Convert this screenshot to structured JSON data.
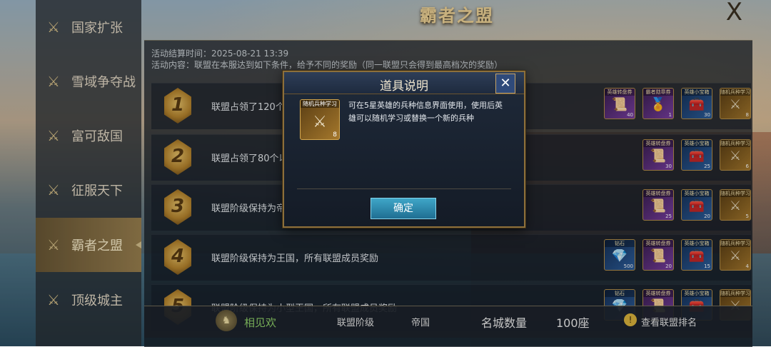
{
  "page_title": "霸者之盟",
  "close_label": "X",
  "sidebar": {
    "items": [
      {
        "label": "国家扩张",
        "active": false
      },
      {
        "label": "雪域争夺战",
        "active": false
      },
      {
        "label": "富可敌国",
        "active": false
      },
      {
        "label": "征服天下",
        "active": false
      },
      {
        "label": "霸者之盟",
        "active": true
      },
      {
        "label": "顶级城主",
        "active": false
      }
    ]
  },
  "info": {
    "end_time": "活动结算时间：2025-08-21 13:39",
    "content": "活动内容：联盟在本服达到如下条件，给予不同的奖励（同一联盟只会得到最高档次的奖励）"
  },
  "rows": [
    {
      "rank": "1",
      "desc": "联盟占领了120个",
      "rewards": [
        {
          "name": "英雄转盘券",
          "count": "40",
          "color": "purple"
        },
        {
          "name": "霸者勋章券",
          "count": "1",
          "color": "purple"
        },
        {
          "name": "英雄小宝箱",
          "count": "30",
          "color": "blue"
        },
        {
          "name": "随机兵种学习",
          "count": "8",
          "color": "gold"
        }
      ]
    },
    {
      "rank": "2",
      "desc": "联盟占领了80个以",
      "rewards": [
        {
          "name": "英雄转盘券",
          "count": "30",
          "color": "purple"
        },
        {
          "name": "英雄小宝箱",
          "count": "25",
          "color": "blue"
        },
        {
          "name": "随机兵种学习",
          "count": "6",
          "color": "gold"
        }
      ]
    },
    {
      "rank": "3",
      "desc": "联盟阶级保持为帝",
      "rewards": [
        {
          "name": "英雄转盘券",
          "count": "25",
          "color": "purple"
        },
        {
          "name": "英雄小宝箱",
          "count": "20",
          "color": "blue"
        },
        {
          "name": "随机兵种学习",
          "count": "5",
          "color": "gold"
        }
      ]
    },
    {
      "rank": "4",
      "desc": "联盟阶级保持为王国，所有联盟成员奖励",
      "rewards": [
        {
          "name": "钻石",
          "count": "500",
          "color": "blue"
        },
        {
          "name": "英雄转盘券",
          "count": "20",
          "color": "purple"
        },
        {
          "name": "英雄小宝箱",
          "count": "15",
          "color": "blue"
        },
        {
          "name": "随机兵种学习",
          "count": "4",
          "color": "gold"
        }
      ]
    },
    {
      "rank": "5",
      "desc": "联盟阶级保持为小型王国，所有联盟成员奖励",
      "rewards": [
        {
          "name": "钻石",
          "count": "",
          "color": "blue"
        },
        {
          "name": "英雄转盘券",
          "count": "",
          "color": "purple"
        },
        {
          "name": "英雄小宝箱",
          "count": "",
          "color": "blue"
        },
        {
          "name": "随机兵种学习",
          "count": "",
          "color": "gold"
        }
      ]
    }
  ],
  "bottom": {
    "alliance_name": "相见欢",
    "rank_label": "联盟阶级",
    "rank_value": "帝国",
    "city_count_label": "名城数量",
    "city_count_value": "100座",
    "ranking_label": "查看联盟排名"
  },
  "dialog": {
    "title": "道具说明",
    "item_name": "随机兵种学习",
    "item_count": "8",
    "description": "可在5星英雄的兵种信息界面使用，使用后英雄可以随机学习或替换一个新的兵种",
    "confirm_label": "确定"
  },
  "colors": {
    "accent_gold": "#f4d89a",
    "confirm_button": "#3fa6c8",
    "alliance_name": "#8fd16a"
  }
}
